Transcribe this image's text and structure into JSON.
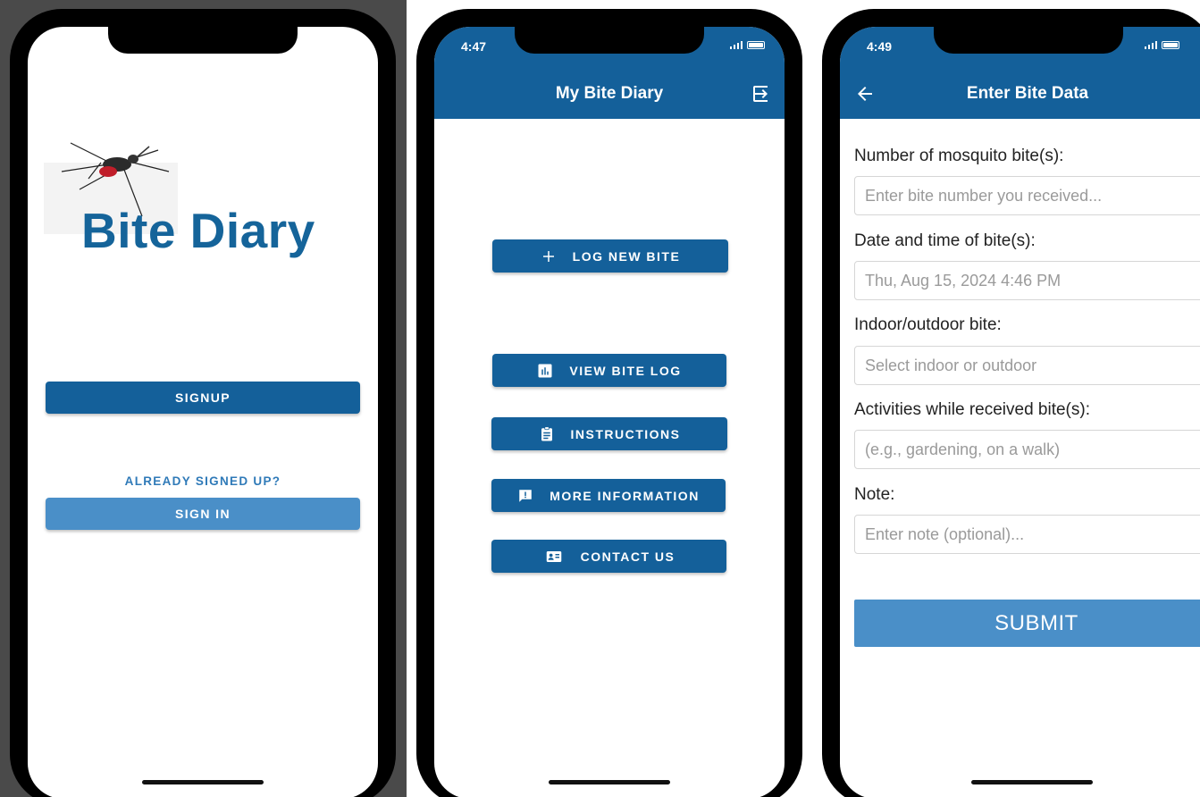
{
  "screen1": {
    "app_title": "Bite Diary",
    "signup_label": "SIGNUP",
    "already_signed_up": "ALREADY SIGNED UP?",
    "signin_label": "SIGN IN"
  },
  "screen2": {
    "status_time": "4:47",
    "title": "My Bite Diary",
    "buttons": [
      {
        "label": "LOG NEW BITE",
        "icon": "plus-icon"
      },
      {
        "label": "VIEW BITE LOG",
        "icon": "bar-chart-icon"
      },
      {
        "label": "INSTRUCTIONS",
        "icon": "clipboard-icon"
      },
      {
        "label": "MORE INFORMATION",
        "icon": "feedback-icon"
      },
      {
        "label": "CONTACT US",
        "icon": "contact-card-icon"
      }
    ],
    "logout_icon": "logout-icon"
  },
  "screen3": {
    "status_time": "4:49",
    "title": "Enter Bite Data",
    "back_icon": "back-arrow-icon",
    "fields": [
      {
        "label": "Number of mosquito bite(s):",
        "placeholder": "Enter bite number you received..."
      },
      {
        "label": "Date and time of bite(s):",
        "value": "Thu, Aug 15, 2024 4:46 PM"
      },
      {
        "label": "Indoor/outdoor bite:",
        "placeholder": "Select indoor or outdoor"
      },
      {
        "label": "Activities while received bite(s):",
        "placeholder": "(e.g., gardening, on a walk)"
      },
      {
        "label": "Note:",
        "placeholder": "Enter note (optional)..."
      }
    ],
    "submit_label": "SUBMIT"
  },
  "colors": {
    "primary": "#14609a",
    "light_primary": "#4a8fc8",
    "title_blue": "#15649a"
  }
}
